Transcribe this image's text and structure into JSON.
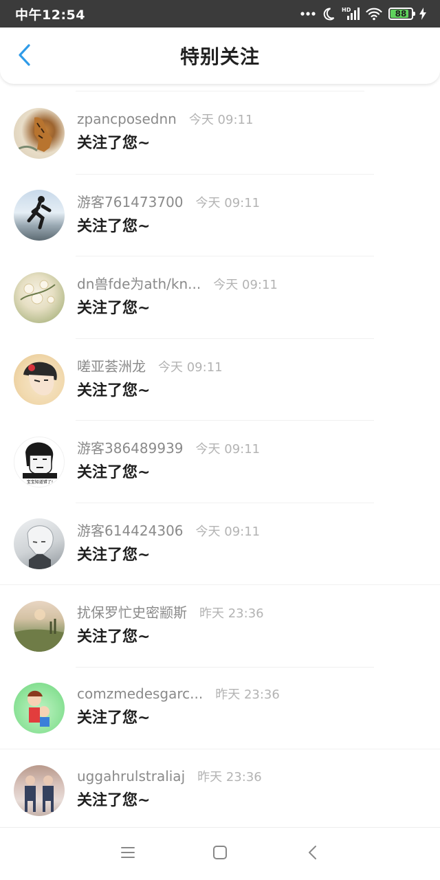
{
  "status_bar": {
    "time": "中午12:54",
    "icons": [
      "more-dots-icon",
      "moon-icon",
      "signal-hd-icon",
      "wifi-icon",
      "battery-icon",
      "charging-bolt-icon"
    ],
    "signal_label": "HD",
    "battery_level": "88",
    "battery_fraction": 0.88,
    "battery_color": "#5fd35c"
  },
  "header": {
    "title": "特别关注",
    "back_icon": "chevron-left-icon",
    "accent_color": "#2f9be8"
  },
  "list": {
    "items": [
      {
        "name": "zpancposednn",
        "time": "今天 09:11",
        "message": "关注了您~",
        "avatar": "tiger painting"
      },
      {
        "name": "游客761473700",
        "time": "今天 09:11",
        "message": "关注了您~",
        "avatar": "runner silhouette"
      },
      {
        "name": "dn兽fde为ath/kn...",
        "time": "今天 09:11",
        "message": "关注了您~",
        "avatar": "flowers"
      },
      {
        "name": "嗟亚荟洲龙",
        "time": "今天 09:11",
        "message": "关注了您~",
        "avatar": "anime girl"
      },
      {
        "name": "游客386489939",
        "time": "今天 09:11",
        "message": "关注了您~",
        "avatar": "meme face",
        "avatar_caption": "宝宝知道错了!"
      },
      {
        "name": "游客614424306",
        "time": "今天 09:11",
        "message": "关注了您~",
        "avatar": "white-haired character"
      },
      {
        "name": "扰保罗忙史密颛斯",
        "time": "昨天 23:36",
        "message": "关注了您~",
        "avatar": "foggy field"
      },
      {
        "name": "comzmedesgarc...",
        "time": "昨天 23:36",
        "message": "关注了您~",
        "avatar": "cartoon kids"
      },
      {
        "name": "uggahrulstraliaj",
        "time": "昨天 23:36",
        "message": "关注了您~",
        "avatar": "two people"
      }
    ]
  },
  "nav_bar": {
    "icons": [
      "menu-icon",
      "home-square-icon",
      "back-triangle-icon"
    ]
  }
}
